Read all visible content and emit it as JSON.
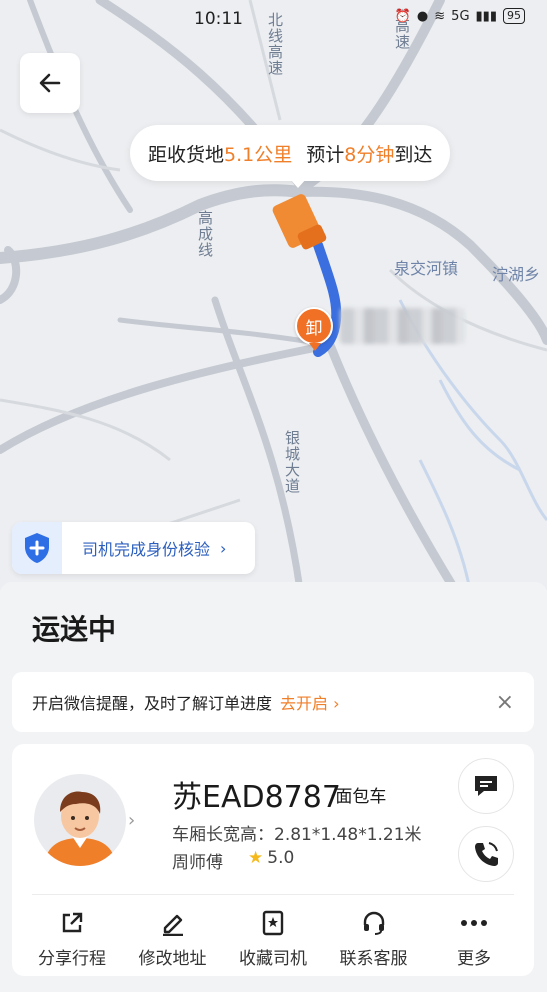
{
  "status_bar": {
    "time": "10:11",
    "battery": "95",
    "network": "5G"
  },
  "map": {
    "road_labels": [
      "北线高速",
      "高速",
      "高成线",
      "银城大道"
    ],
    "place_labels": [
      "泉交河镇",
      "泞湖乡"
    ],
    "unload_pin": "卸"
  },
  "eta": {
    "prefix": "距收货地",
    "distance": "5.1公里",
    "mid": "预计",
    "minutes": "8分钟",
    "suffix": "到达"
  },
  "verify": {
    "label": "司机完成身份核验",
    "chev": "›"
  },
  "panel": {
    "title": "运送中",
    "notice": {
      "text": "开启微信提醒，及时了解订单进度",
      "link": "去开启 ›",
      "close": "×"
    }
  },
  "driver": {
    "plate": "苏EAD8787",
    "vehicle_type": "·面包车",
    "dims": "车厢长宽高：2.81*1.48*1.21米",
    "name": "周师傅",
    "rating": "5.0"
  },
  "actions": [
    {
      "label": "分享行程",
      "icon": "share-icon"
    },
    {
      "label": "修改地址",
      "icon": "edit-icon"
    },
    {
      "label": "收藏司机",
      "icon": "favorite-icon"
    },
    {
      "label": "联系客服",
      "icon": "headset-icon"
    },
    {
      "label": "更多",
      "icon": "more-icon"
    }
  ],
  "colors": {
    "accent": "#f07f2a",
    "route": "#3b6fe0",
    "link": "#2c5fbe"
  }
}
